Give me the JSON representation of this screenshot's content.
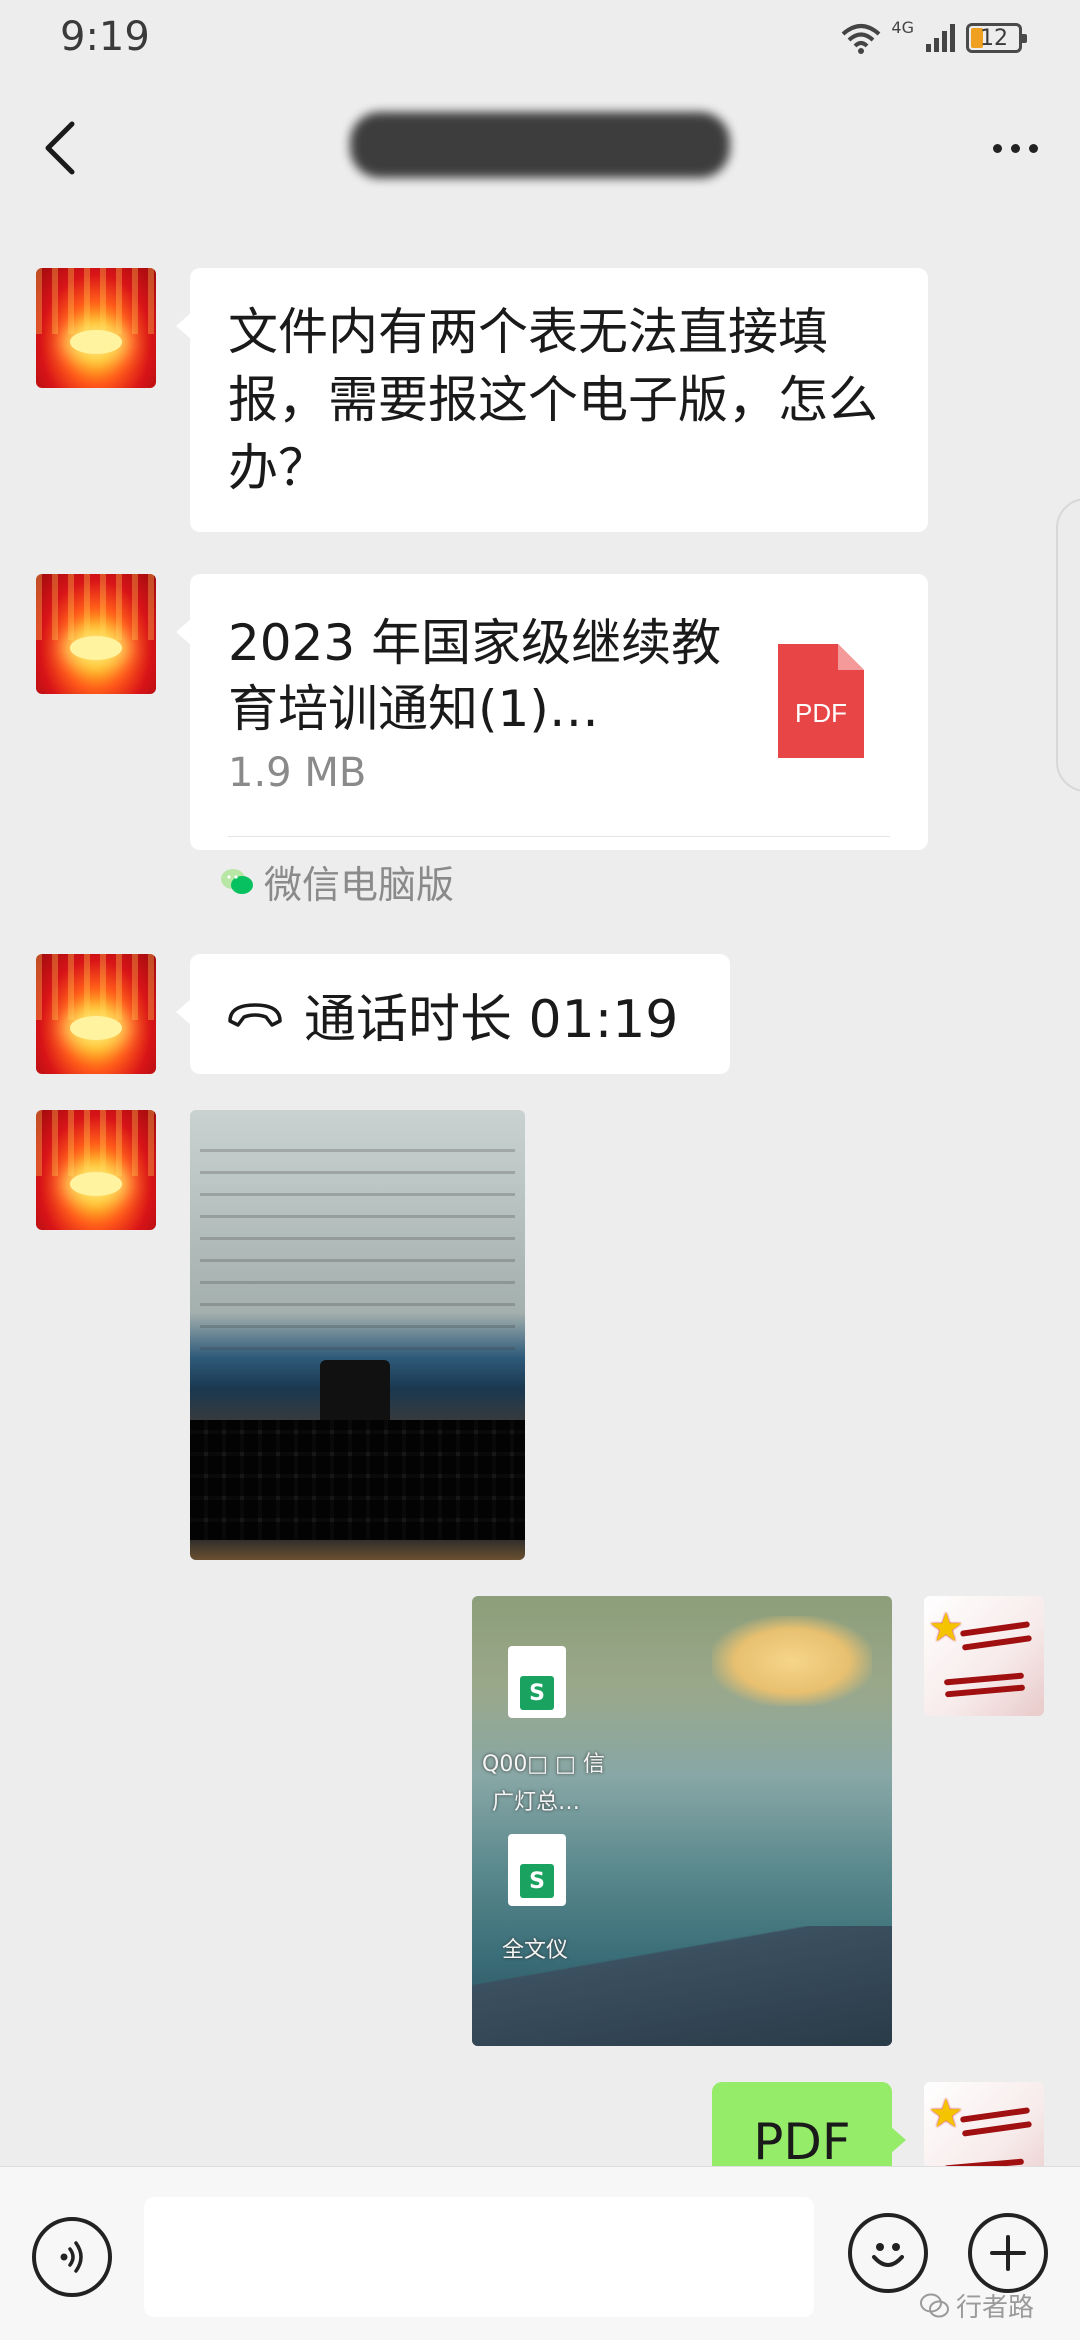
{
  "status_bar": {
    "time": "9:19",
    "network": "4G",
    "battery": "12"
  },
  "header": {
    "title": ""
  },
  "messages": {
    "text": "文件内有两个表无法直接填报，需要报这个电子版，怎么办？",
    "file": {
      "name": "2023 年国家级继续教育培训通知(1)…",
      "size": "1.9 MB",
      "type": "PDF",
      "source": "微信电脑版"
    },
    "call": {
      "label": "通话时长 01:19"
    },
    "desktop_icons": [
      {
        "badge": "S",
        "label": "Q00□ □ 信"
      },
      {
        "badge": "S",
        "label": "广灯总…"
      },
      {
        "badge": "S",
        "label": "全文仪"
      }
    ],
    "outgoing_file_label": "PDF"
  },
  "input_bar": {
    "placeholder": "",
    "watermark": "行者路"
  },
  "colors": {
    "background": "#ededed",
    "bubble_incoming": "#ffffff",
    "bubble_outgoing": "#95ec69",
    "pdf_red": "#e84646",
    "wechat_green": "#07c160"
  }
}
